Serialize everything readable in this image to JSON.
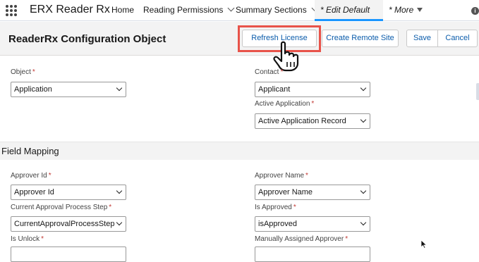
{
  "nav": {
    "app_name": "ERX Reader Rx",
    "items": [
      {
        "label": "Home"
      },
      {
        "label": "Reading Permissions"
      },
      {
        "label": "Summary Sections"
      },
      {
        "label": "* Edit Default"
      },
      {
        "label": "* More"
      }
    ]
  },
  "header": {
    "title": "ReaderRx Configuration Object",
    "buttons": {
      "refresh": "Refresh License",
      "create_remote": "Create Remote Site",
      "save": "Save",
      "cancel": "Cancel"
    }
  },
  "form": {
    "object": {
      "label": "Object",
      "value": "Application"
    },
    "contact": {
      "label": "Contact",
      "value": "Applicant"
    },
    "active_application": {
      "label": "Active Application",
      "value": "Active Application Record"
    }
  },
  "field_mapping": {
    "title": "Field Mapping",
    "approver_id": {
      "label": "Approver Id",
      "value": "Approver Id"
    },
    "approver_name": {
      "label": "Approver Name",
      "value": "Approver Name"
    },
    "current_step": {
      "label": "Current Approval Process Step",
      "value": "CurrentApprovalProcessStep"
    },
    "is_approved": {
      "label": "Is Approved",
      "value": "isApproved"
    },
    "is_unlock": {
      "label": "Is Unlock",
      "value": ""
    },
    "manually_assigned": {
      "label": "Manually Assigned Approver",
      "value": ""
    }
  },
  "required_marker": "*",
  "icons": {
    "app_launcher": "app-launcher-icon",
    "info": "info-icon",
    "hand": "hand-pointer-icon",
    "cursor": "mouse-cursor-icon"
  },
  "colors": {
    "highlight": "#e8534a",
    "link": "#0b5cab",
    "active_tab": "#1b96ff",
    "required": "#c23934"
  }
}
